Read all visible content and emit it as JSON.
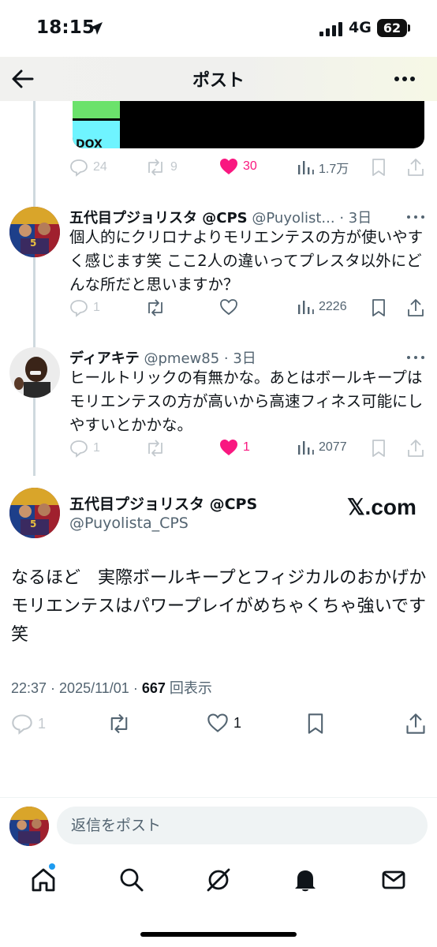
{
  "status_bar": {
    "time": "18:15",
    "network": "4G",
    "battery": "62"
  },
  "header": {
    "title": "ポスト"
  },
  "media": {
    "partial_text": "DOX"
  },
  "prev_post": {
    "actions": {
      "replies": "24",
      "reposts": "9",
      "likes": "30",
      "views": "1.7万"
    }
  },
  "reply_1": {
    "name": "五代目プジョリスタ @CPS",
    "handle": "@Puyolist...",
    "time": "· 3日",
    "text": "個人的にクリロナよりモリエンテスの方が使いやすく感じます笑 ここ2人の違いってプレスタ以外にどんな所だと思いますか？",
    "actions": {
      "replies": "1",
      "views": "2226"
    }
  },
  "reply_2": {
    "name": "ディアキテ",
    "handle": "@pmew85",
    "time": "· 3日",
    "text": "ヒールトリックの有無かな。あとはボールキープはモリエンテスの方が高いから高速フィネス可能にしやすいとかかな。",
    "actions": {
      "replies": "1",
      "likes": "1",
      "views": "2077"
    }
  },
  "main_post": {
    "name": "五代目プジョリスタ @CPS",
    "handle": "@Puyolista_CPS",
    "watermark": "𝕏.com",
    "text": "なるほど　実際ボールキープとフィジカルのおかげかモリエンテスはパワープレイがめちゃくちゃ強いです笑",
    "time": "22:37",
    "date": "2025/11/01",
    "views": "667",
    "views_label": "回表示",
    "actions": {
      "replies": "1",
      "likes": "1"
    }
  },
  "reply_bar": {
    "placeholder": "返信をポスト"
  },
  "colors": {
    "like": "#f91880",
    "accent": "#1d9bf0",
    "muted": "#536471"
  },
  "tabbar": {
    "icons": [
      "home-icon",
      "search-icon",
      "grok-icon",
      "notifications-icon",
      "messages-icon"
    ]
  }
}
